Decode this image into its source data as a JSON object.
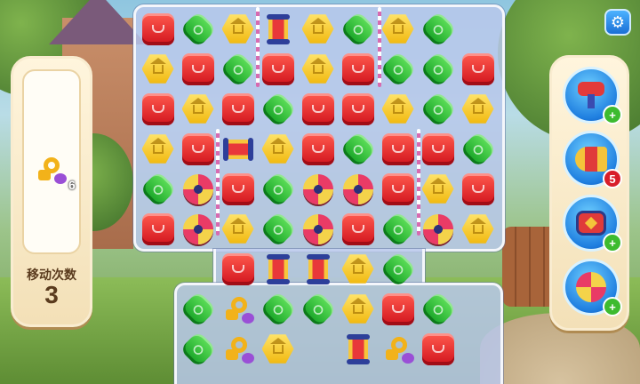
{
  "goal": {
    "item_icon": "key-bag-icon",
    "remaining": "6"
  },
  "moves": {
    "label": "移动次数",
    "value": "3"
  },
  "settings": {
    "icon": "gear-icon"
  },
  "boosters": [
    {
      "icon": "hammer-icon",
      "badge": "+"
    },
    {
      "icon": "rocket-icon",
      "badge": "5"
    },
    {
      "icon": "bag-icon",
      "badge": "+"
    },
    {
      "icon": "fan-icon",
      "badge": "+"
    }
  ],
  "board": {
    "rows": [
      [
        "red",
        "green",
        "yellow",
        "rocket",
        "yellow",
        "green",
        "yellow",
        "green",
        null
      ],
      [
        "yellow",
        "red",
        "green",
        "red",
        "yellow",
        "red",
        "green",
        "green",
        "red"
      ],
      [
        "red",
        "yellow",
        "red",
        "green",
        "red",
        "red",
        "yellow",
        "green",
        "yellow"
      ],
      [
        "yellow",
        "red",
        "rocket-h",
        "yellow",
        "red",
        "green",
        "red",
        "red",
        "green"
      ],
      [
        "green",
        "bow",
        "red",
        "green",
        "bow",
        "bow",
        "red",
        "yellow",
        "red"
      ],
      [
        "red",
        "bow",
        "yellow",
        "green",
        "bow",
        "red",
        "green",
        "bow",
        "yellow"
      ],
      [
        null,
        null,
        "red",
        "rocket",
        "rocket",
        "yellow",
        "green",
        null,
        null
      ],
      [
        null,
        "green",
        "key",
        "green",
        "green",
        "yellow",
        "red",
        "green",
        null
      ],
      [
        null,
        "green",
        "key",
        "yellow",
        null,
        "rocket",
        "key",
        "red",
        null
      ]
    ]
  }
}
